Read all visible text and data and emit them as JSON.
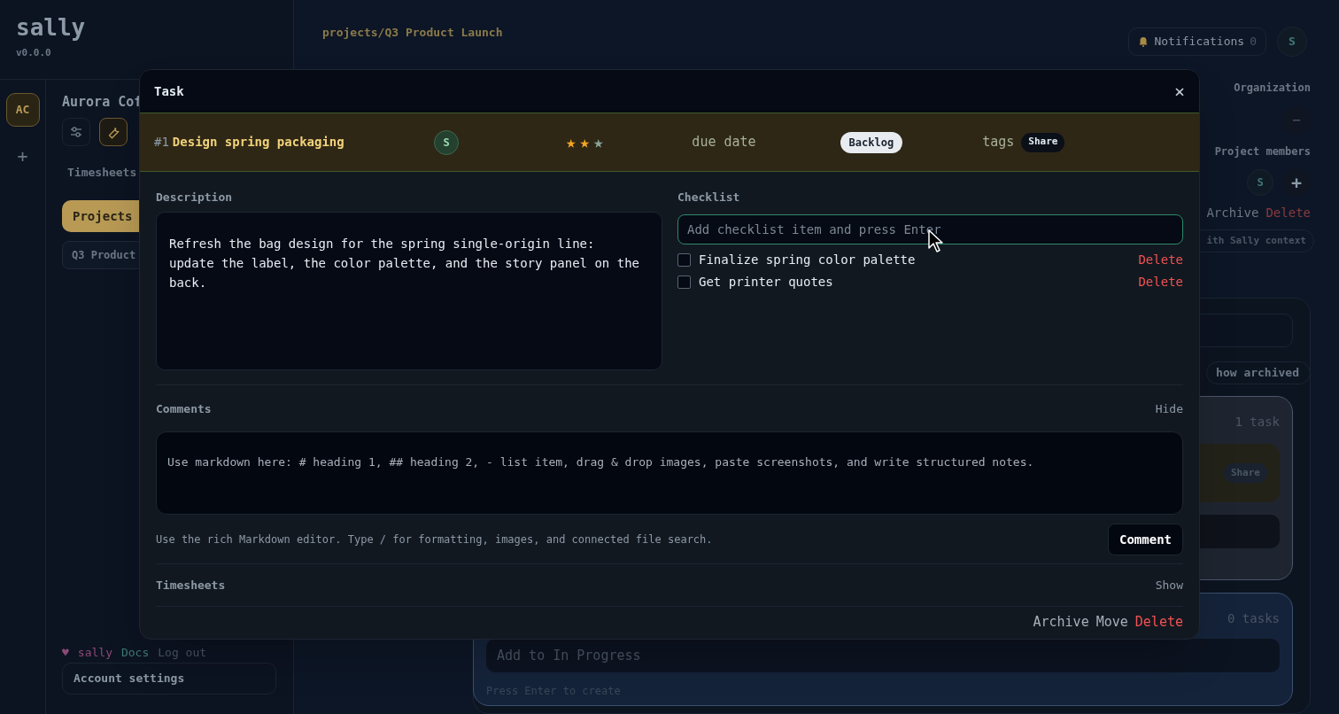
{
  "app": {
    "name": "sally",
    "version": "v0.0.0"
  },
  "breadcrumb": "projects/Q3 Product Launch",
  "topbar": {
    "notifications_label": "Notifications",
    "notifications_count": "0",
    "user_initial": "S"
  },
  "rail": {
    "org_initials": "AC",
    "add_label": "+"
  },
  "sidebar": {
    "org_name": "Aurora Cof",
    "timesheets": "Timesheets",
    "items": [
      {
        "label": "Projects",
        "selected": true
      },
      {
        "label": "Q3 Product",
        "selected": false
      }
    ],
    "footer": {
      "heart": "♥",
      "user": "sally",
      "docs": "Docs",
      "logout": "Log out"
    },
    "account": "Account settings"
  },
  "right_panel": {
    "organization": "Organization",
    "org_button": "−",
    "members_label": "Project members",
    "member_initial": "S",
    "add_member": "+",
    "archive": "Archive",
    "delete": "Delete",
    "context_button": "ith Sally context",
    "archived_button": "how archived"
  },
  "board": {
    "columns": [
      {
        "count": "1 task",
        "tag": "Share"
      },
      {
        "count": "0 tasks",
        "placeholder": "Add to In Progress",
        "hint": "Press Enter to create"
      }
    ]
  },
  "modal": {
    "title": "Task",
    "close": "×",
    "task": {
      "number": "#1",
      "title": "Design spring packaging",
      "assignee": "S",
      "stars": 2,
      "due": "due date",
      "status": "Backlog",
      "tags_label": "tags",
      "tag": "Share"
    },
    "description": {
      "label": "Description",
      "value": "Refresh the bag design for the spring single-origin line: update the label, the color palette, and the story panel on the back."
    },
    "checklist": {
      "label": "Checklist",
      "placeholder": "Add checklist item and press Enter",
      "items": [
        {
          "text": "Finalize spring color palette",
          "checked": false,
          "action": "Delete"
        },
        {
          "text": "Get printer quotes",
          "checked": false,
          "action": "Delete"
        }
      ]
    },
    "comments": {
      "label": "Comments",
      "toggle": "Hide",
      "placeholder": "Use markdown here: # heading 1, ## heading 2, - list item, drag & drop images, paste screenshots, and write structured notes.",
      "hint": "Use the rich Markdown editor. Type / for formatting, images, and connected file search.",
      "button": "Comment"
    },
    "timesheets": {
      "label": "Timesheets",
      "toggle": "Show"
    },
    "actions": [
      {
        "label": "Archive",
        "kind": "plain"
      },
      {
        "label": "Move",
        "kind": "plain"
      },
      {
        "label": "Delete",
        "kind": "danger"
      }
    ]
  }
}
